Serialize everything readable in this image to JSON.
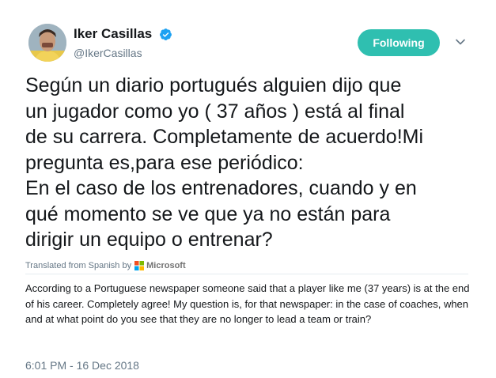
{
  "user": {
    "display_name": "Iker Casillas",
    "handle": "@IkerCasillas",
    "verified_icon": "verified-badge-icon",
    "avatar": "avatar-photo"
  },
  "actions": {
    "follow_label": "Following",
    "menu_icon": "chevron-down-icon"
  },
  "tweet": {
    "text": "Según un diario portugués alguien dijo que\nun jugador como yo ( 37 años ) está al final\nde su carrera. Completamente de acuerdo!Mi\npregunta es,para ese periódico:\nEn el caso de los entrenadores, cuando y en\nqué momento se ve que ya no están para\ndirigir un equipo o entrenar?",
    "translated_from": "Translated from Spanish by",
    "translator": "Microsoft",
    "translator_icon": "microsoft-logo-icon",
    "translation": "According to a Portuguese newspaper someone said that a player like me (37 years) is at the end of his career. Completely agree! My question is, for that newspaper: in the case of coaches, when and at what point do you see that they are no longer to lead a team or train?",
    "timestamp": "6:01 PM - 16 Dec 2018"
  },
  "colors": {
    "follow_button": "#2fbfb0",
    "verified": "#1da1f2",
    "secondary_text": "#657786"
  }
}
